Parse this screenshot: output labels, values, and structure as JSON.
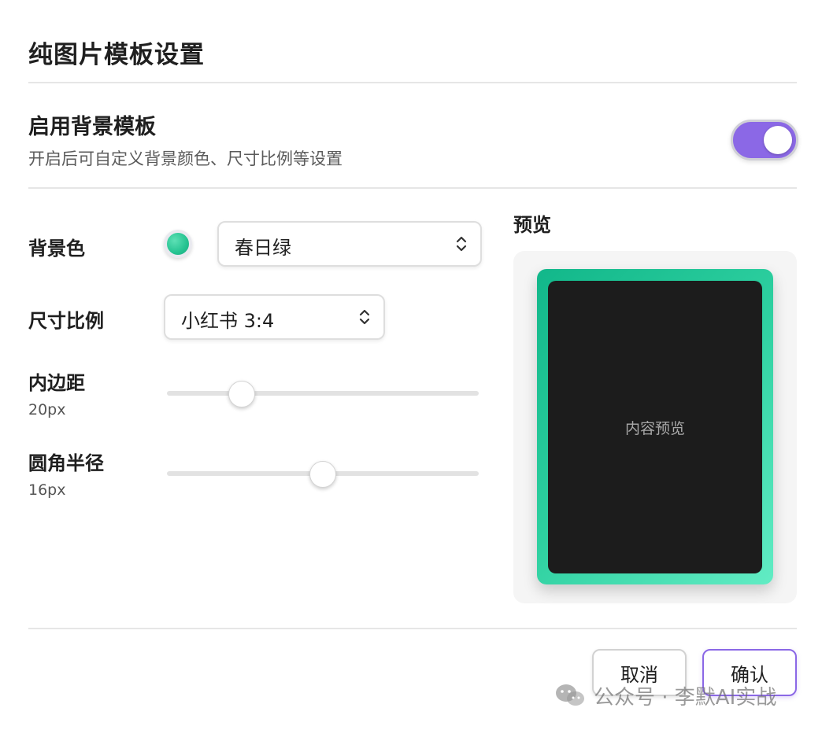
{
  "dialog": {
    "title": "纯图片模板设置"
  },
  "enable_section": {
    "title": "启用背景模板",
    "description": "开启后可自定义背景颜色、尺寸比例等设置",
    "toggle_on": true,
    "accent_color": "#8b68e6"
  },
  "settings": {
    "background_color": {
      "label": "背景色",
      "selected": "春日绿",
      "swatch_color": "#25c391"
    },
    "aspect_ratio": {
      "label": "尺寸比例",
      "selected": "小红书 3:4"
    },
    "padding": {
      "label": "内边距",
      "value_text": "20px",
      "fraction": 0.24
    },
    "radius": {
      "label": "圆角半径",
      "value_text": "16px",
      "fraction": 0.5
    }
  },
  "preview": {
    "title": "预览",
    "content_text": "内容预览"
  },
  "footer": {
    "cancel_label": "取消",
    "confirm_label": "确认"
  },
  "watermark": {
    "text": "公众号 · 李默AI实战",
    "icon": "wechat-icon"
  }
}
